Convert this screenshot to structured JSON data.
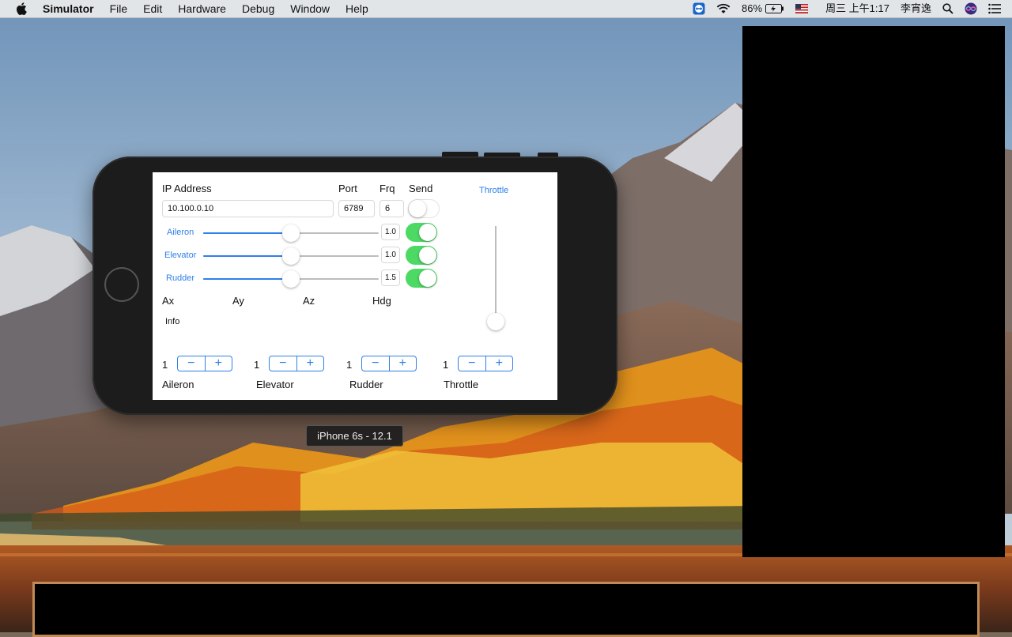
{
  "menubar": {
    "app_name": "Simulator",
    "items": [
      "File",
      "Edit",
      "Hardware",
      "Debug",
      "Window",
      "Help"
    ],
    "status": {
      "battery": "86%",
      "datetime": "周三 上午1:17",
      "user": "李宵逸"
    },
    "icons": [
      "apple-icon",
      "teamviewer-icon",
      "wifi-icon",
      "battery-icon",
      "us-flag-icon",
      "search-icon",
      "siri-icon",
      "notification-center-icon"
    ]
  },
  "app": {
    "header": {
      "ip_label": "IP Address",
      "port_label": "Port",
      "frq_label": "Frq",
      "send_label": "Send",
      "throttle_label": "Throttle"
    },
    "ip_value": "10.100.0.10",
    "port_value": "6789",
    "frq_value": "6",
    "send_on": false,
    "sliders": [
      {
        "label": "Aileron",
        "value": "1.0",
        "level": 0.5,
        "enabled": true
      },
      {
        "label": "Elevator",
        "value": "1.0",
        "level": 0.5,
        "enabled": true
      },
      {
        "label": "Rudder",
        "value": "1.5",
        "level": 0.5,
        "enabled": true
      }
    ],
    "sensors": [
      "Ax",
      "Ay",
      "Az",
      "Hdg"
    ],
    "info_label": "Info",
    "throttle_level": 0.0,
    "steppers": [
      {
        "value": "1",
        "label": "Aileron"
      },
      {
        "value": "1",
        "label": "Elevator"
      },
      {
        "value": "1",
        "label": "Rudder"
      },
      {
        "value": "1",
        "label": "Throttle"
      }
    ],
    "stepper_minus": "−",
    "stepper_plus": "+"
  },
  "device_tooltip": "iPhone 6s - 12.1",
  "colors": {
    "accent": "#2f80e8",
    "toggle_on": "#4cd964"
  }
}
